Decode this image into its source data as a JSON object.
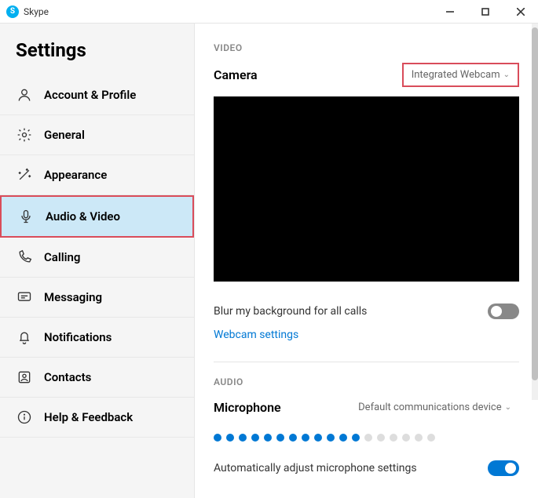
{
  "window": {
    "title": "Skype",
    "logo_letter": "S"
  },
  "sidebar": {
    "title": "Settings",
    "items": [
      {
        "label": "Account & Profile",
        "icon": "person"
      },
      {
        "label": "General",
        "icon": "gear"
      },
      {
        "label": "Appearance",
        "icon": "wand"
      },
      {
        "label": "Audio & Video",
        "icon": "mic",
        "active": true,
        "highlighted": true
      },
      {
        "label": "Calling",
        "icon": "phone"
      },
      {
        "label": "Messaging",
        "icon": "chat"
      },
      {
        "label": "Notifications",
        "icon": "bell"
      },
      {
        "label": "Contacts",
        "icon": "contacts"
      },
      {
        "label": "Help & Feedback",
        "icon": "info"
      }
    ]
  },
  "video": {
    "section_label": "VIDEO",
    "camera_label": "Camera",
    "camera_value": "Integrated Webcam",
    "blur_label": "Blur my background for all calls",
    "blur_on": false,
    "webcam_settings": "Webcam settings"
  },
  "audio": {
    "section_label": "AUDIO",
    "mic_label": "Microphone",
    "mic_value": "Default communications device",
    "mic_level_filled": 12,
    "mic_level_total": 18,
    "auto_adjust_label": "Automatically adjust microphone settings",
    "auto_adjust_on": true
  }
}
